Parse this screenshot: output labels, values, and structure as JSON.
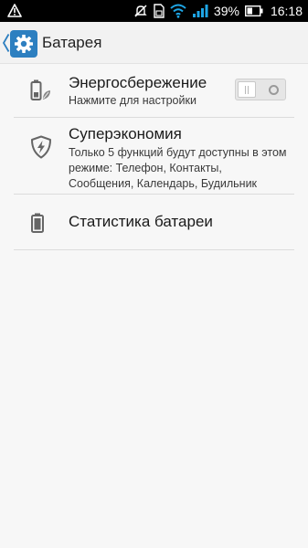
{
  "status_bar": {
    "battery_percent": "39%",
    "time": "16:18",
    "icons": [
      "warning-icon",
      "mute-icon",
      "sim-icon",
      "wifi-icon",
      "signal-icon",
      "battery-icon"
    ]
  },
  "action_bar": {
    "title": "Батарея",
    "app_icon": "settings-gear-icon",
    "accent_color": "#2d7fc0"
  },
  "items": [
    {
      "icon": "battery-leaf-icon",
      "title": "Энергосбережение",
      "subtitle": "Нажмите для настройки",
      "toggle": {
        "state": "off"
      }
    },
    {
      "icon": "shield-bolt-icon",
      "title": "Суперэкономия",
      "subtitle": "Только 5 функций будут доступны в этом режиме: Телефон, Контакты, Сообщения, Календарь, Будильник"
    },
    {
      "icon": "battery-icon",
      "title": "Статистика батареи"
    }
  ]
}
